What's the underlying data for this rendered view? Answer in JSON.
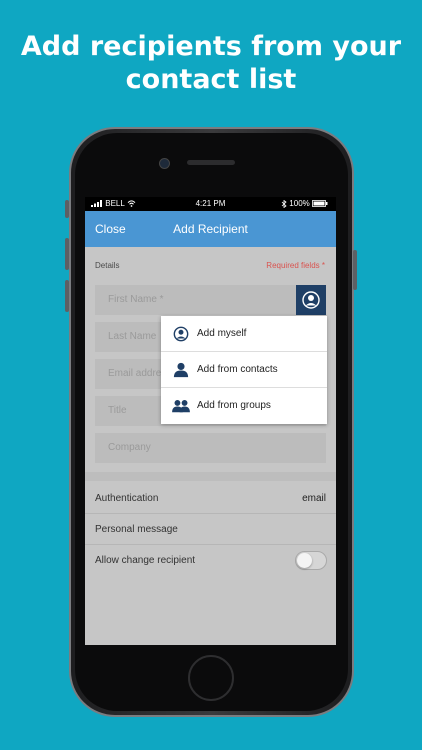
{
  "headline": {
    "line1": "Add recipients from your",
    "line2": "contact list"
  },
  "statusbar": {
    "carrier": "BELL",
    "time": "4:21 PM",
    "battery": "100%"
  },
  "navbar": {
    "close": "Close",
    "title": "Add Recipient"
  },
  "section": {
    "label": "Details",
    "required": "Required fields *"
  },
  "fields": {
    "first_name": "First Name *",
    "last_name": "Last Name",
    "email": "Email addre",
    "title": "Title",
    "company": "Company"
  },
  "dropdown": {
    "add_myself": "Add myself",
    "add_contacts": "Add from contacts",
    "add_groups": "Add from groups"
  },
  "settings": {
    "auth_label": "Authentication",
    "auth_value": "email",
    "personal_message": "Personal message",
    "allow_change": "Allow change recipient"
  },
  "colors": {
    "background": "#0fa7c2",
    "navbar": "#4a96d3",
    "accent_dark": "#1f3f66",
    "required": "#d9534f"
  }
}
